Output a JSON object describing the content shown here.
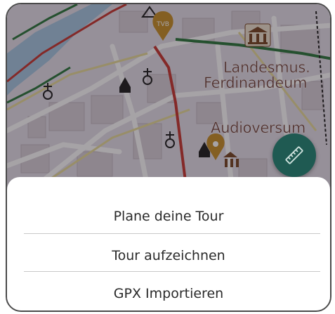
{
  "map": {
    "poi_badge": "TVB",
    "labels": {
      "landesmus": "Landesmus.",
      "ferdinandeum": "Ferdinandeum",
      "audioversum": "Audioversum"
    }
  },
  "fab": {
    "icon": "ruler-pencil-icon"
  },
  "sheet": {
    "items": [
      {
        "label": "Plane deine Tour"
      },
      {
        "label": "Tour aufzeichnen"
      },
      {
        "label": "GPX Importieren"
      }
    ]
  },
  "colors": {
    "fab": "#1f5a52",
    "map_road_red": "#c93b34",
    "map_road_green": "#2f7a3f",
    "poi_pin": "#c9922a"
  }
}
